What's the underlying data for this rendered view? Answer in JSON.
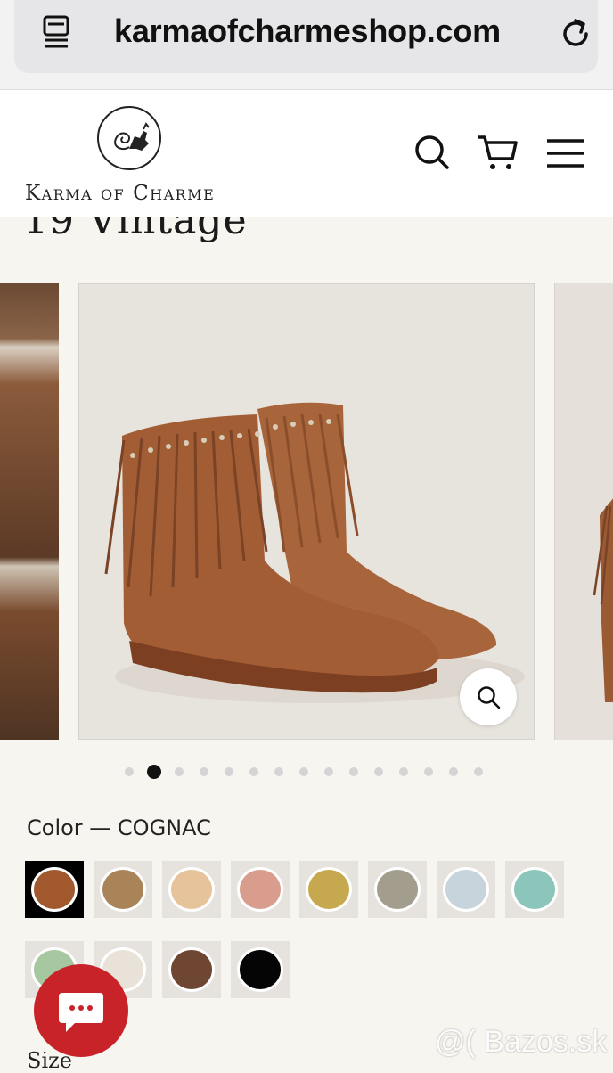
{
  "browser": {
    "url": "karmaofcharmeshop.com"
  },
  "header": {
    "logo_text": "Karma of Charme"
  },
  "product": {
    "title": "19 Vintage",
    "gallery": {
      "slide_count": 15,
      "active_index": 1
    },
    "color_label": "Color — COGNAC",
    "colors": [
      {
        "hex": "#a0582c",
        "selected": true
      },
      {
        "hex": "#a98459"
      },
      {
        "hex": "#e7c39c"
      },
      {
        "hex": "#d99d8e"
      },
      {
        "hex": "#c6a94f"
      },
      {
        "hex": "#a29d8c"
      },
      {
        "hex": "#c8d4dc"
      },
      {
        "hex": "#8cc6ba"
      },
      {
        "hex": "#a6c8a0"
      },
      {
        "hex": "#e9e2d8"
      },
      {
        "hex": "#6e4632"
      },
      {
        "hex": "#050505"
      }
    ],
    "size_label": "Size"
  },
  "watermark": "@( Bazos.sk"
}
